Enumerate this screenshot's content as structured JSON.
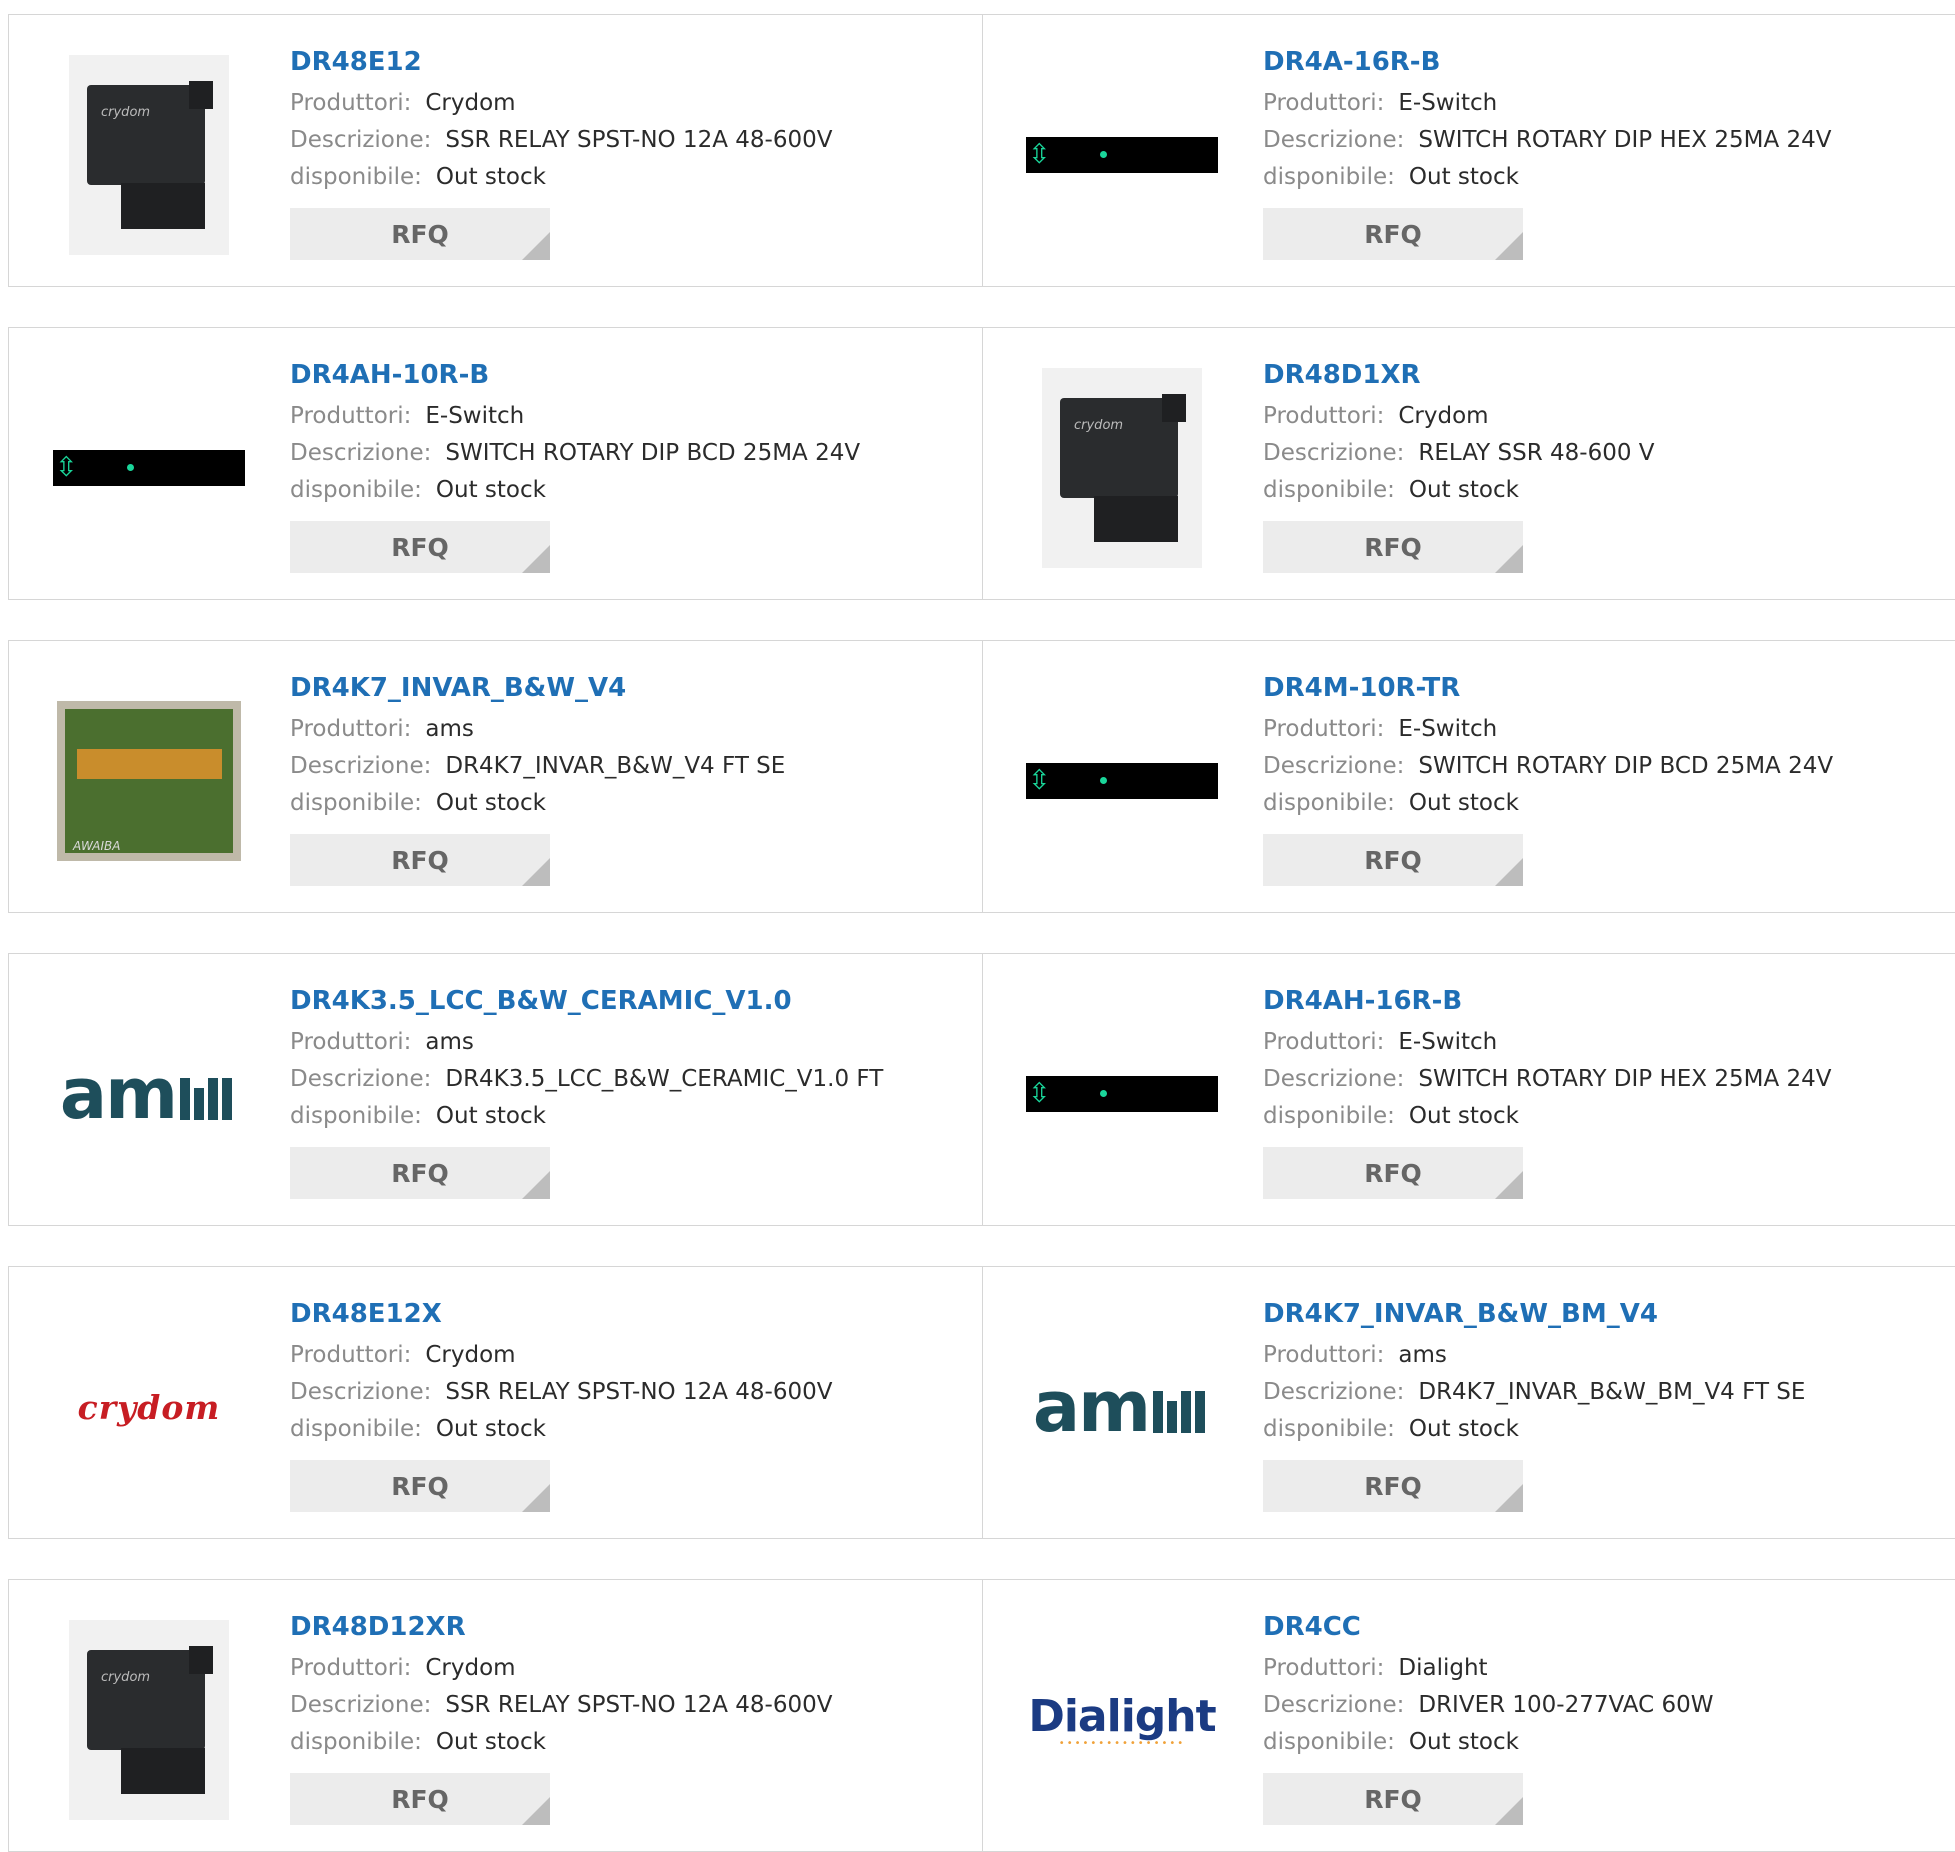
{
  "labels": {
    "manufacturer": "Produttori:",
    "description": "Descrizione:",
    "availability": "disponibile:",
    "rfq": "RFQ"
  },
  "products": [
    {
      "part": "DR48E12",
      "manufacturer": "Crydom",
      "description": "SSR RELAY SPST-NO 12A 48-600V",
      "availability": "Out stock",
      "image": "ssr-relay"
    },
    {
      "part": "DR4A-16R-B",
      "manufacturer": "E-Switch",
      "description": "SWITCH ROTARY DIP HEX 25MA 24V",
      "availability": "Out stock",
      "image": "dip-switch"
    },
    {
      "part": "DR4AH-10R-B",
      "manufacturer": "E-Switch",
      "description": "SWITCH ROTARY DIP BCD 25MA 24V",
      "availability": "Out stock",
      "image": "dip-switch"
    },
    {
      "part": "DR48D1XR",
      "manufacturer": "Crydom",
      "description": "RELAY SSR 48-600 V",
      "availability": "Out stock",
      "image": "ssr-relay"
    },
    {
      "part": "DR4K7_INVAR_B&W_V4",
      "manufacturer": "ams",
      "description": "DR4K7_INVAR_B&W_V4 FT SE",
      "availability": "Out stock",
      "image": "pcb"
    },
    {
      "part": "DR4M-10R-TR",
      "manufacturer": "E-Switch",
      "description": "SWITCH ROTARY DIP BCD 25MA 24V",
      "availability": "Out stock",
      "image": "dip-switch"
    },
    {
      "part": "DR4K3.5_LCC_B&W_CERAMIC_V1.0",
      "manufacturer": "ams",
      "description": "DR4K3.5_LCC_B&W_CERAMIC_V1.0 FT",
      "availability": "Out stock",
      "image": "ams-logo"
    },
    {
      "part": "DR4AH-16R-B",
      "manufacturer": "E-Switch",
      "description": "SWITCH ROTARY DIP HEX 25MA 24V",
      "availability": "Out stock",
      "image": "dip-switch"
    },
    {
      "part": "DR48E12X",
      "manufacturer": "Crydom",
      "description": "SSR RELAY SPST-NO 12A 48-600V",
      "availability": "Out stock",
      "image": "crydom-logo"
    },
    {
      "part": "DR4K7_INVAR_B&W_BM_V4",
      "manufacturer": "ams",
      "description": "DR4K7_INVAR_B&W_BM_V4 FT SE",
      "availability": "Out stock",
      "image": "ams-logo"
    },
    {
      "part": "DR48D12XR",
      "manufacturer": "Crydom",
      "description": "SSR RELAY SPST-NO 12A 48-600V",
      "availability": "Out stock",
      "image": "ssr-relay"
    },
    {
      "part": "DR4CC",
      "manufacturer": "Dialight",
      "description": "DRIVER 100-277VAC 60W",
      "availability": "Out stock",
      "image": "dialight-logo"
    }
  ],
  "logos": {
    "ams": "am",
    "crydom": "crydom",
    "crydom_relay_text": "crydom",
    "pcb_label": "AWAIBA",
    "dialight": "Dialight"
  },
  "colors": {
    "title": "#1f6fb5",
    "border": "#d6d6d6",
    "rfq_bg": "#ececec",
    "dip_led": "#1ad69a",
    "crydom_red": "#c71d23",
    "ams_teal": "#1e4e5b"
  }
}
